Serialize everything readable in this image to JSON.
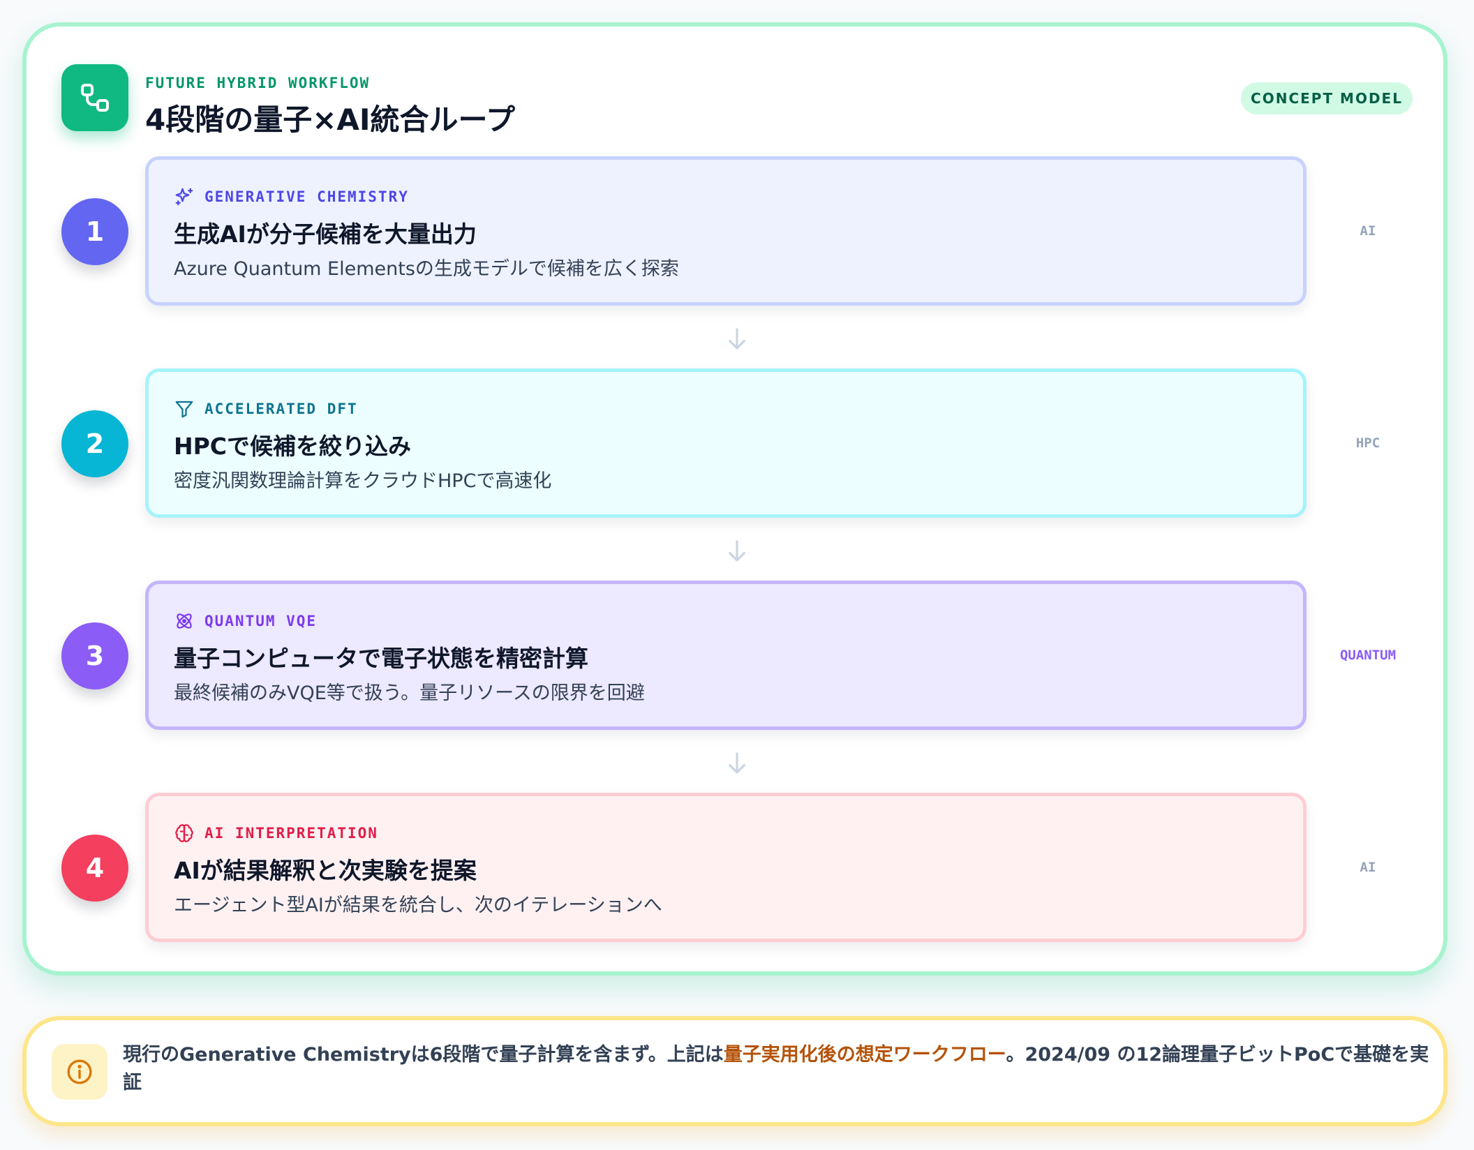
{
  "header": {
    "eyebrow": "FUTURE HYBRID WORKFLOW",
    "title": "4段階の量子×AI統合ループ",
    "badge": "CONCEPT MODEL"
  },
  "steps": [
    {
      "number": "1",
      "tag": "GENERATIVE CHEMISTRY",
      "icon": "sparkles-icon",
      "title": "生成AIが分子候補を大量出力",
      "desc": "Azure Quantum Elementsの生成モデルで候補を広く探索",
      "side": "AI",
      "color": "#6366f1"
    },
    {
      "number": "2",
      "tag": "ACCELERATED DFT",
      "icon": "filter-icon",
      "title": "HPCで候補を絞り込み",
      "desc": "密度汎関数理論計算をクラウドHPCで高速化",
      "side": "HPC",
      "color": "#06b6d4"
    },
    {
      "number": "3",
      "tag": "QUANTUM VQE",
      "icon": "atom-icon",
      "title": "量子コンピュータで電子状態を精密計算",
      "desc": "最終候補のみVQE等で扱う。量子リソースの限界を回避",
      "side": "QUANTUM",
      "color": "#8b5cf6"
    },
    {
      "number": "4",
      "tag": "AI INTERPRETATION",
      "icon": "brain-icon",
      "title": "AIが結果解釈と次実験を提案",
      "desc": "エージェント型AIが結果を統合し、次のイテレーションへ",
      "side": "AI",
      "color": "#f43f5e"
    }
  ],
  "note": {
    "text_before": "現行のGenerative Chemistryは6段階で量子計算を含まず。上記は",
    "highlight": "量子実用化後の想定ワークフロー",
    "text_after": "。2024/09 の12論理量子ビットPoCで基礎を実証"
  },
  "colors": {
    "accent": "#10b981",
    "highlight": "#b45309",
    "quantum_label": "#8b5cf6"
  }
}
